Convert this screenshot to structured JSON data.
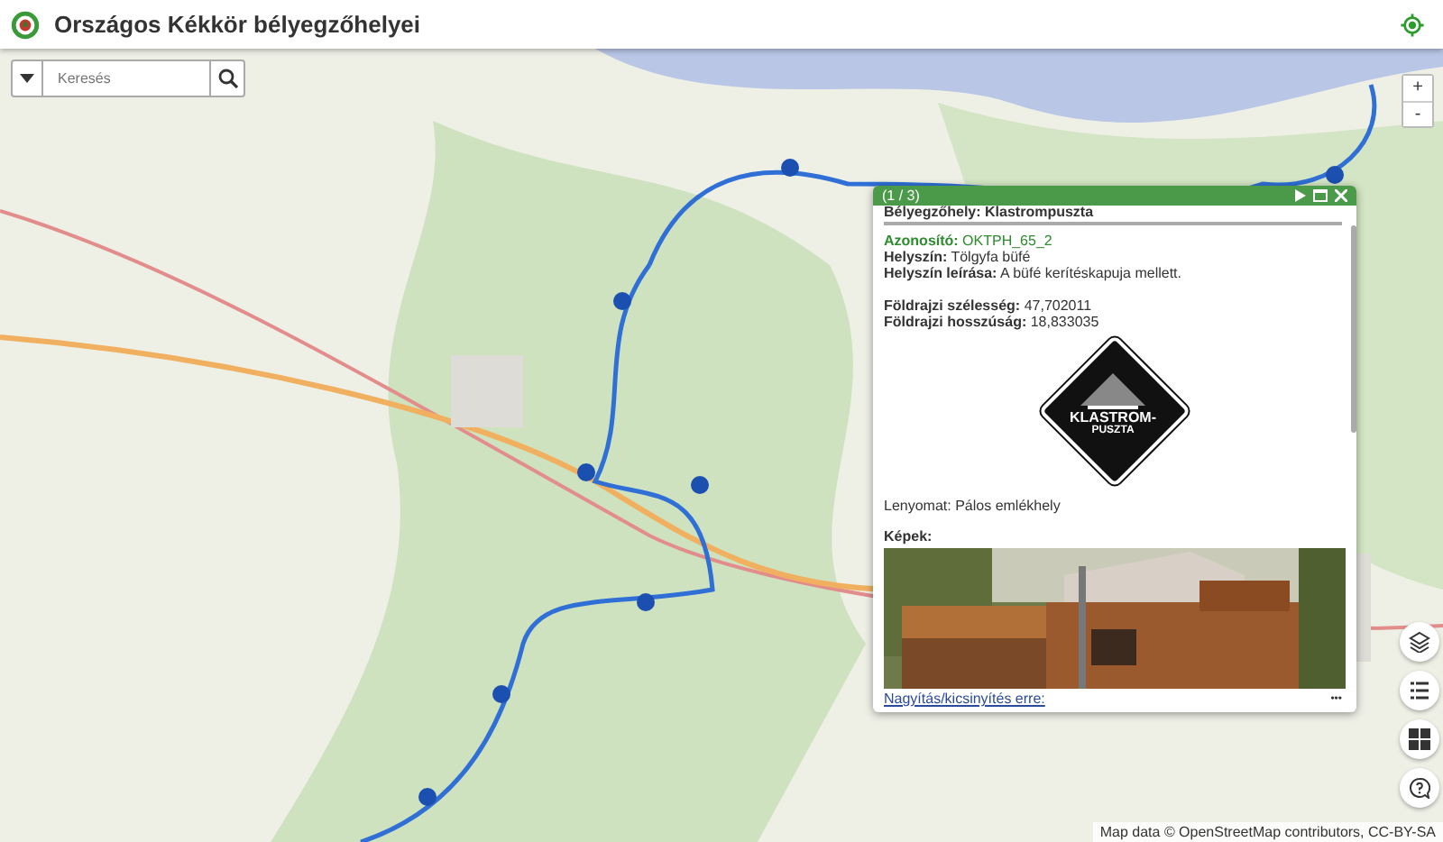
{
  "header": {
    "title": "Országos Kékkör bélyegzőhelyei"
  },
  "search": {
    "placeholder": "Keresés"
  },
  "zoom": {
    "in": "+",
    "out": "-"
  },
  "popup": {
    "counter": "(1 / 3)",
    "heading": "Bélyegzőhely: Klastrompuszta",
    "id_label": "Azonosító:",
    "id_value": "OKTPH_65_2",
    "fields": [
      {
        "label": "Helyszín:",
        "value": "Tölgyfa büfé"
      },
      {
        "label": "Helyszín leírása:",
        "value": "A büfé kerítéskapuja mellett."
      }
    ],
    "coords": [
      {
        "label": "Földrajzi szélesség:",
        "value": "47,702011"
      },
      {
        "label": "Földrajzi hosszúság:",
        "value": "18,833035"
      }
    ],
    "stamp": {
      "line1": "KLASTROM-",
      "line2": "PUSZTA"
    },
    "imprint": "Lenyomat: Pálos emlékhely",
    "images_label": "Képek:",
    "zoom_link": "Nagyítás/kicsinyítés erre:",
    "more": "•••"
  },
  "attribution": "Map data © OpenStreetMap contributors, CC-BY-SA"
}
